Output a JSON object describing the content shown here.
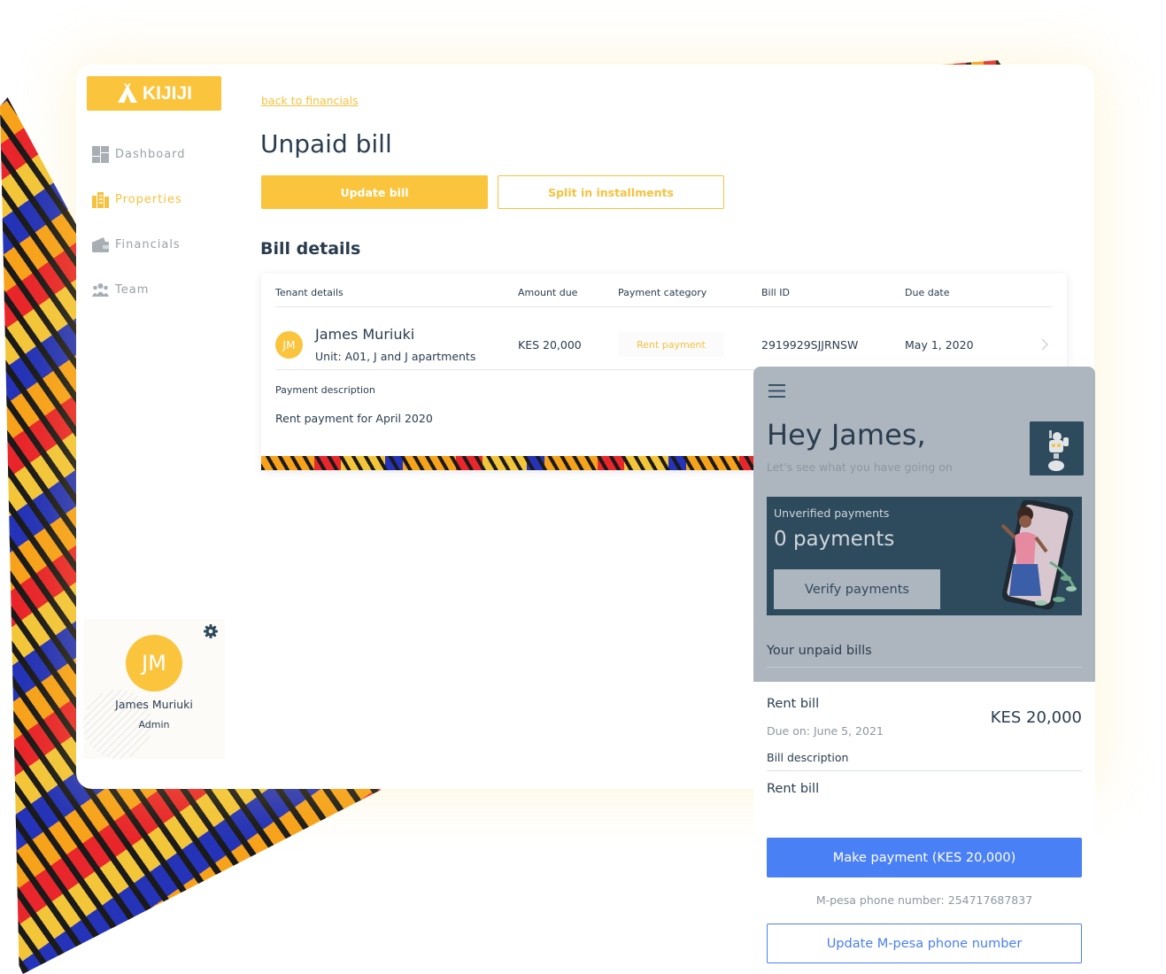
{
  "brand": {
    "name": "KIJIJI",
    "accent": "#fbc43d",
    "primary_blue": "#4a80f5",
    "dark_teal": "#2e4a5d"
  },
  "sidebar": {
    "items": [
      {
        "label": "Dashboard",
        "icon": "dashboard-icon",
        "active": false
      },
      {
        "label": "Properties",
        "icon": "buildings-icon",
        "active": true
      },
      {
        "label": "Financials",
        "icon": "wallet-icon",
        "active": false
      },
      {
        "label": "Team",
        "icon": "team-icon",
        "active": false
      }
    ],
    "profile": {
      "initials": "JM",
      "name": "James Muriuki",
      "role": "Admin",
      "settings_icon": "gear-icon"
    }
  },
  "main": {
    "back_link": "back to financials",
    "title": "Unpaid bill",
    "update_button": "Update bill",
    "split_button": "Split in installments",
    "section_title": "Bill details",
    "table": {
      "headers": [
        "Tenant details",
        "Amount due",
        "Payment category",
        "Bill ID",
        "Due date"
      ],
      "row": {
        "initials": "JM",
        "tenant_name": "James Muriuki",
        "unit": "Unit: A01, J and J apartments",
        "amount": "KES 20,000",
        "category": "Rent payment",
        "bill_id": "2919929SJJRNSW",
        "due_date": "May 1, 2020"
      },
      "description_label": "Payment description",
      "description_text": "Rent payment for April 2020"
    }
  },
  "mobile": {
    "greeting": "Hey James,",
    "subtitle": "Let's see what you have going on",
    "unverified": {
      "label": "Unverified payments",
      "count": "0 payments",
      "button": "Verify payments"
    },
    "unpaid_title": "Your unpaid bills",
    "bill": {
      "title": "Rent bill",
      "due": "Due on: June 5, 2021",
      "amount": "KES 20,000",
      "description_label": "Bill description",
      "description_text": "Rent bill"
    },
    "pay_button": "Make payment (KES 20,000)",
    "mpesa_text": "M-pesa phone number: 254717687837",
    "update_phone_button": "Update M-pesa phone number"
  }
}
